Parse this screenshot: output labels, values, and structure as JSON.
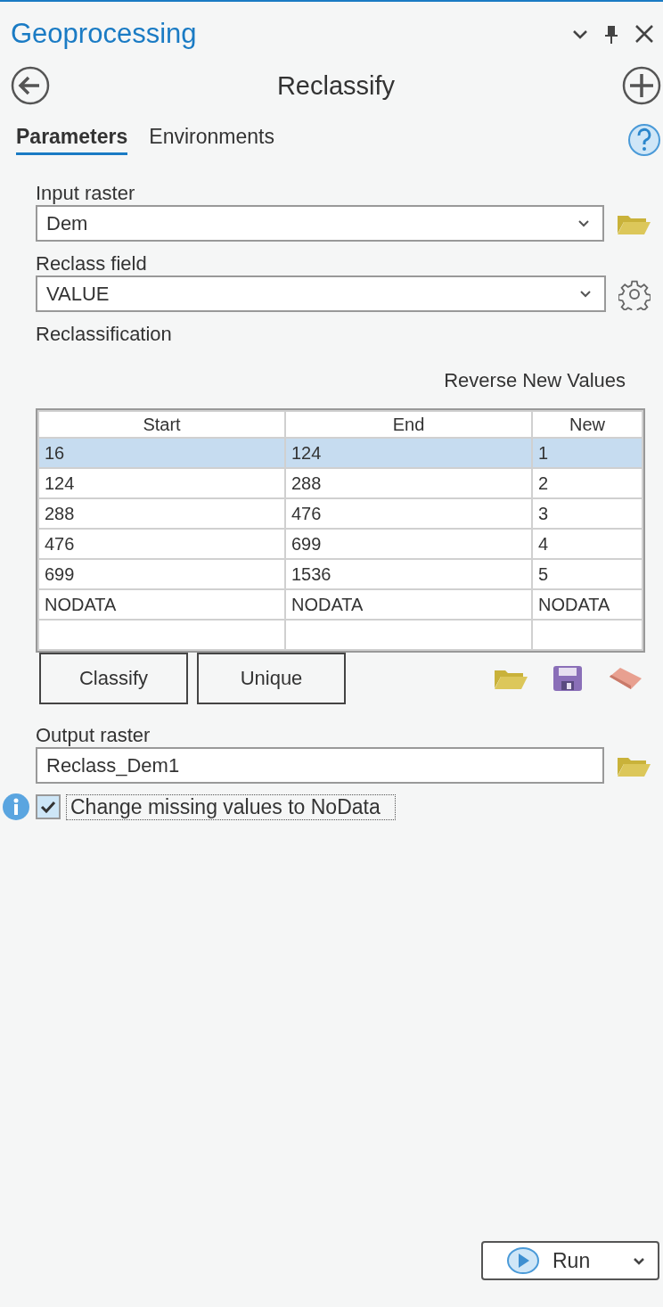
{
  "panel_title": "Geoprocessing",
  "tool_title": "Reclassify",
  "tabs": [
    {
      "label": "Parameters",
      "selected": true
    },
    {
      "label": "Environments",
      "selected": false
    }
  ],
  "input_raster": {
    "label": "Input raster",
    "value": "Dem"
  },
  "reclass_field": {
    "label": "Reclass field",
    "value": "VALUE"
  },
  "reclassification": {
    "label": "Reclassification",
    "reverse_link": "Reverse New Values",
    "columns": [
      "Start",
      "End",
      "New"
    ],
    "rows": [
      {
        "cells": [
          "16",
          "124",
          "1"
        ],
        "selected": true
      },
      {
        "cells": [
          "124",
          "288",
          "2"
        ],
        "selected": false
      },
      {
        "cells": [
          "288",
          "476",
          "3"
        ],
        "selected": false
      },
      {
        "cells": [
          "476",
          "699",
          "4"
        ],
        "selected": false
      },
      {
        "cells": [
          "699",
          "1536",
          "5"
        ],
        "selected": false
      },
      {
        "cells": [
          "NODATA",
          "NODATA",
          "NODATA"
        ],
        "selected": false
      }
    ]
  },
  "buttons": [
    "Classify",
    "Unique"
  ],
  "output_raster": {
    "label": "Output raster",
    "value": "Reclass_Dem1"
  },
  "missing_to_nodata": {
    "label": "Change missing values to NoData",
    "checked": true
  },
  "run_button": "Run"
}
